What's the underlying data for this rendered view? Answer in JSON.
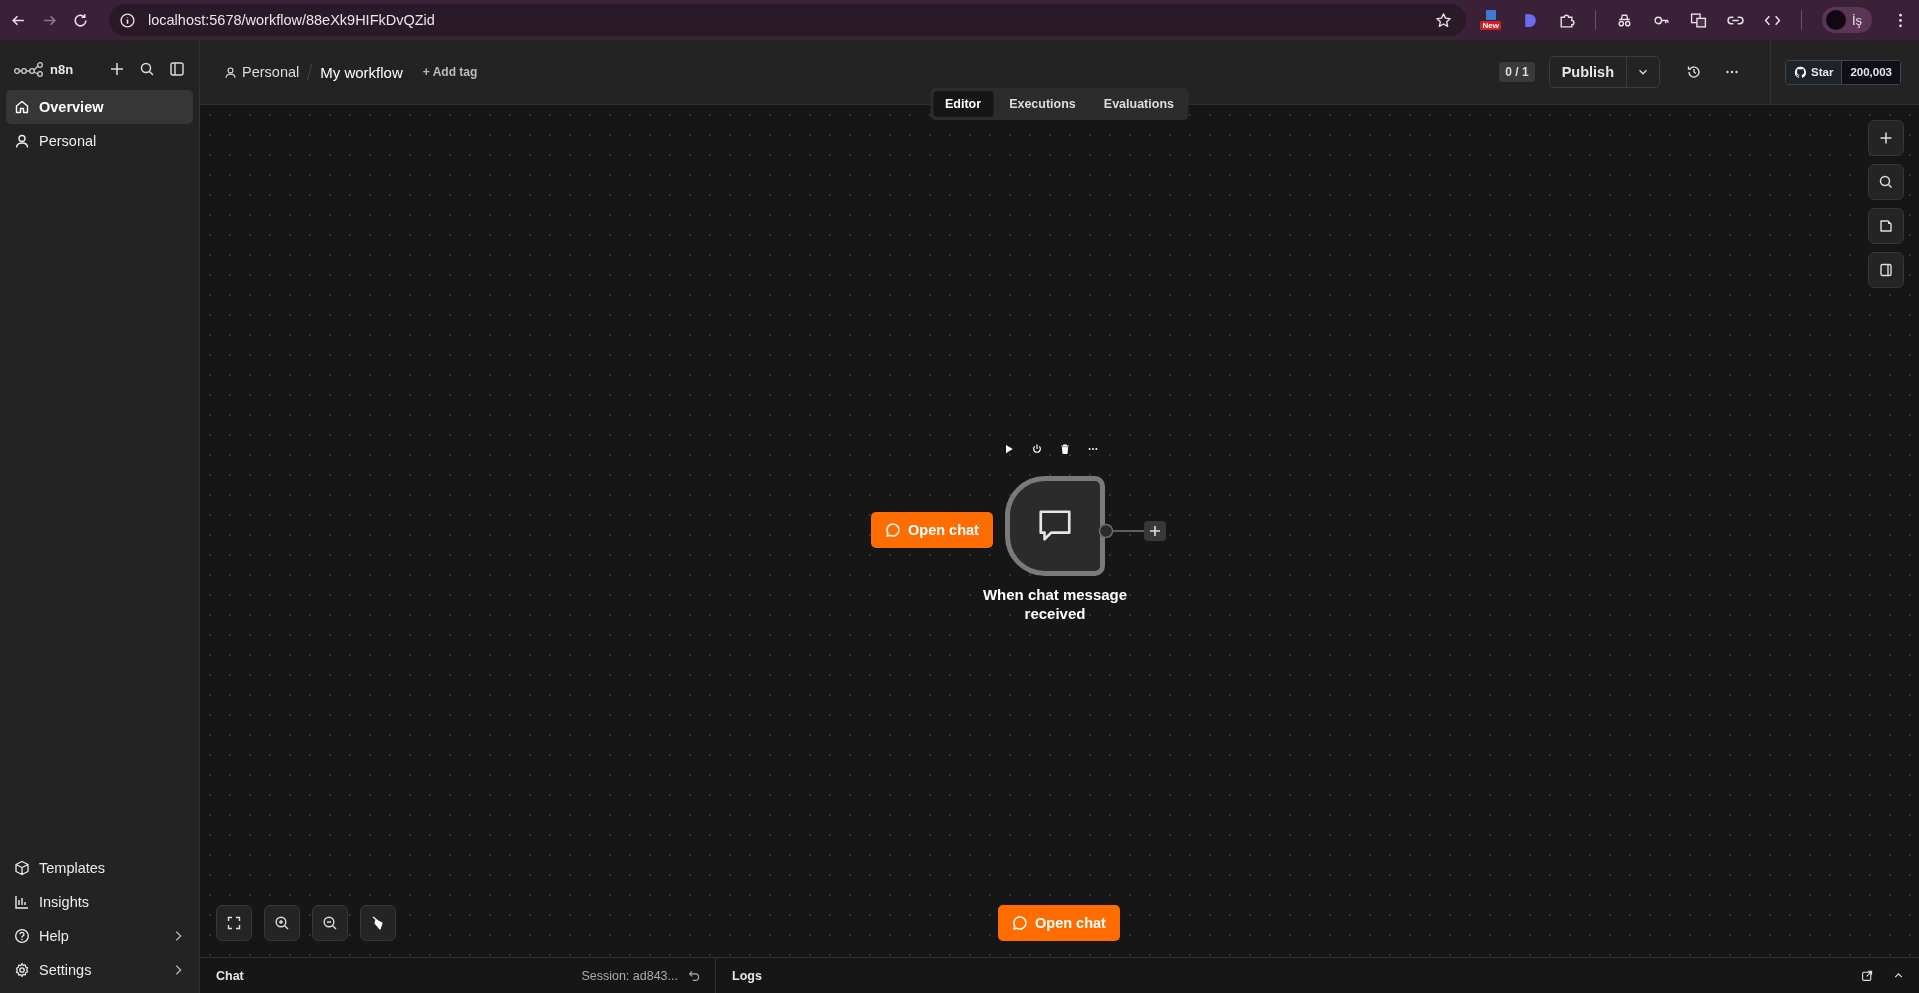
{
  "browser": {
    "url": "localhost:5678/workflow/88eXk9HIFkDvQZid",
    "extension_badge": "New",
    "profile": "İş"
  },
  "sidebar": {
    "logo": "n8n",
    "nav": [
      {
        "label": "Overview",
        "selected": true
      },
      {
        "label": "Personal",
        "selected": false
      }
    ],
    "bottom": [
      {
        "label": "Templates",
        "expandable": false
      },
      {
        "label": "Insights",
        "expandable": false
      },
      {
        "label": "Help",
        "expandable": true
      },
      {
        "label": "Settings",
        "expandable": true
      }
    ]
  },
  "header": {
    "project": "Personal",
    "workflow": "My workflow",
    "add_tag": "+ Add tag",
    "counter": "0 / 1",
    "publish": "Publish",
    "github_star": "Star",
    "github_count": "200,003"
  },
  "tabs": [
    {
      "label": "Editor",
      "selected": true
    },
    {
      "label": "Executions",
      "selected": false
    },
    {
      "label": "Evaluations",
      "selected": false
    }
  ],
  "node": {
    "name": "When chat message received",
    "open_chat": "Open chat"
  },
  "canvas_button": "Open chat",
  "bottom_panel": {
    "chat": "Chat",
    "session": "Session: ad843...",
    "logs": "Logs"
  }
}
